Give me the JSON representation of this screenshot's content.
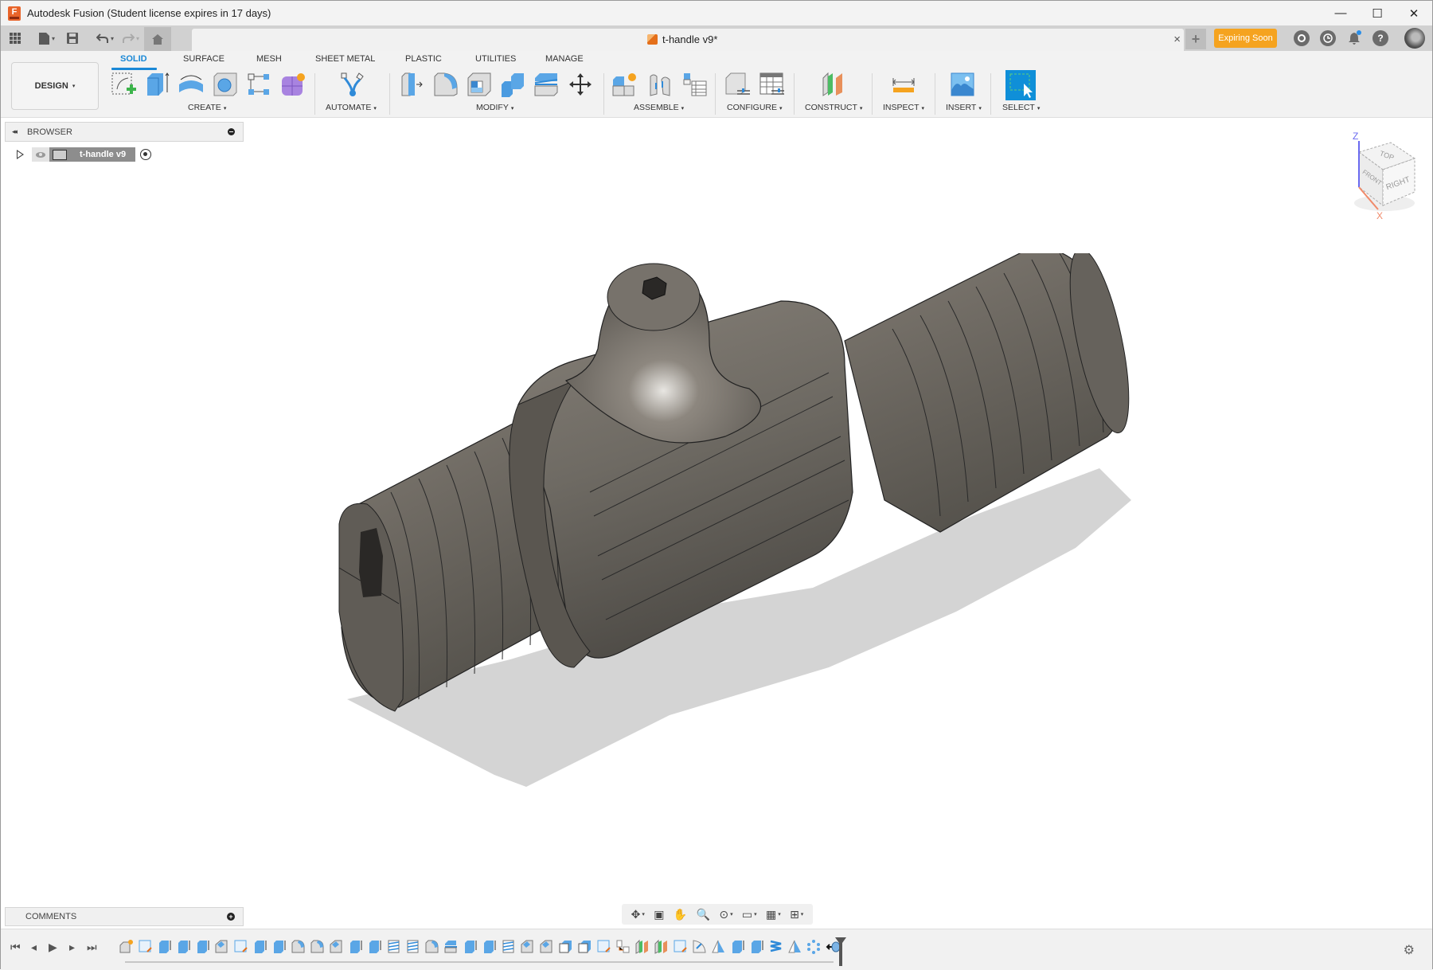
{
  "app": {
    "title": "Autodesk Fusion (Student license expires in 17 days)",
    "logo_letter": "F",
    "window_controls": {
      "minimize": "—",
      "maximize": "☐",
      "close": "✕"
    }
  },
  "tabbar": {
    "quick_access": [
      {
        "name": "data-panel-icon",
        "glyph": "▦"
      },
      {
        "name": "file-icon",
        "glyph": "▬",
        "has_caret": true
      },
      {
        "name": "save-icon",
        "glyph": "💾"
      },
      {
        "name": "undo-icon",
        "glyph": "↶",
        "has_caret": true
      },
      {
        "name": "redo-icon",
        "glyph": "↷",
        "has_caret": true
      }
    ],
    "home_glyph": "⌂",
    "document_tab": {
      "title": "t-handle v9*",
      "close": "×"
    },
    "new_tab": "+",
    "expiring_label": "Expiring Soon",
    "caret": "▾"
  },
  "toolbar": {
    "workspace": {
      "label": "DESIGN"
    },
    "tabs": [
      "SOLID",
      "SURFACE",
      "MESH",
      "SHEET METAL",
      "PLASTIC",
      "UTILITIES",
      "MANAGE"
    ],
    "active_tab": "SOLID",
    "groups": {
      "create": "CREATE",
      "automate": "AUTOMATE",
      "modify": "MODIFY",
      "assemble": "ASSEMBLE",
      "configure": "CONFIGURE",
      "construct": "CONSTRUCT",
      "inspect": "INSPECT",
      "insert": "INSERT",
      "select": "SELECT"
    },
    "caret": "▾"
  },
  "browser": {
    "title": "BROWSER",
    "collapse_glyph": "◂◂",
    "root_node": "t-handle v9"
  },
  "comments": {
    "title": "COMMENTS",
    "add_glyph": "+"
  },
  "viewcube": {
    "faces": {
      "top": "TOP",
      "front": "FRONT",
      "right": "RIGHT"
    },
    "axes": {
      "z": "Z",
      "x": "X"
    }
  },
  "navbar": {
    "items": [
      {
        "name": "orbit-icon",
        "glyph": "✥",
        "caret": true
      },
      {
        "name": "look-at-icon",
        "glyph": "▣",
        "caret": false
      },
      {
        "name": "pan-icon",
        "glyph": "✋",
        "caret": false
      },
      {
        "name": "zoom-icon",
        "glyph": "🔍",
        "caret": false
      },
      {
        "name": "fit-icon",
        "glyph": "⊙",
        "caret": true
      },
      {
        "name": "display-settings-icon",
        "glyph": "▭",
        "caret": true
      },
      {
        "name": "grid-icon",
        "glyph": "▦",
        "caret": true
      },
      {
        "name": "viewports-icon",
        "glyph": "⊞",
        "caret": true
      }
    ],
    "caret": "▾"
  },
  "timeline": {
    "controls": [
      {
        "name": "go-to-start-icon",
        "glyph": "⏮"
      },
      {
        "name": "step-back-icon",
        "glyph": "◂"
      },
      {
        "name": "play-icon",
        "glyph": "▶"
      },
      {
        "name": "step-forward-icon",
        "glyph": "▸"
      },
      {
        "name": "go-to-end-icon",
        "glyph": "⏭"
      }
    ],
    "features": [
      "new-component",
      "sketch",
      "extrude",
      "extrude",
      "extrude",
      "chamfer",
      "sketch",
      "extrude",
      "extrude",
      "fillet",
      "fillet",
      "chamfer",
      "extrude",
      "extrude",
      "thread",
      "thread",
      "fillet",
      "split-body",
      "extrude",
      "extrude",
      "thread",
      "chamfer",
      "chamfer",
      "shell",
      "shell",
      "sketch",
      "joint",
      "plane",
      "plane",
      "sketch",
      "revolve",
      "draft",
      "extrude",
      "extrude",
      "coil",
      "draft",
      "pattern",
      "rollback-marker"
    ],
    "settings_glyph": "⚙"
  },
  "colors": {
    "accent_blue": "#1a88d6",
    "expiring_orange": "#f5a31f",
    "model_gray": "#6f6b64",
    "select_blue": "#0f8fd8"
  }
}
